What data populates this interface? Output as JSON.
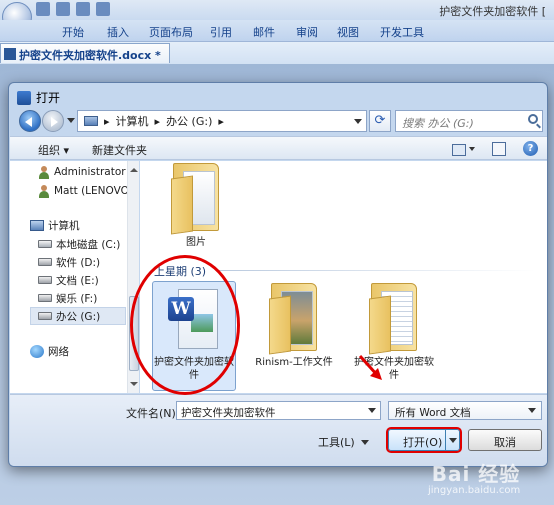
{
  "word": {
    "doc_title": "护密文件夹加密软件 [",
    "tabs": [
      "开始",
      "插入",
      "页面布局",
      "引用",
      "邮件",
      "审阅",
      "视图",
      "开发工具"
    ],
    "doc_tab": "护密文件夹加密软件.docx *"
  },
  "dialog": {
    "title": "打开",
    "breadcrumb": [
      "计算机",
      "办公 (G:)"
    ],
    "search_placeholder": "搜索 办公 (G:)",
    "toolbar": {
      "organize": "组织 ▾",
      "new_folder": "新建文件夹"
    },
    "nav": [
      {
        "label": "Administrator (",
        "icon": "user-icon"
      },
      {
        "label": "Matt (LENOVO-",
        "icon": "user-icon"
      },
      {
        "label": "计算机",
        "icon": "computer-icon"
      },
      {
        "label": "本地磁盘 (C:)",
        "icon": "drive-icon"
      },
      {
        "label": "软件 (D:)",
        "icon": "drive-icon"
      },
      {
        "label": "文档 (E:)",
        "icon": "drive-icon"
      },
      {
        "label": "娱乐 (F:)",
        "icon": "drive-icon"
      },
      {
        "label": "办公 (G:)",
        "icon": "drive-icon",
        "selected": true
      },
      {
        "label": "网络",
        "icon": "network-icon"
      }
    ],
    "files": {
      "top": {
        "label": "图片"
      },
      "group_header": "上星期 (3)",
      "items": [
        {
          "label": "护密文件夹加密软件",
          "type": "word-document"
        },
        {
          "label": "Rinism-工作文件",
          "type": "folder"
        },
        {
          "label": "护密文件夹加密软件",
          "type": "folder"
        }
      ]
    },
    "bottom": {
      "filename_label": "文件名(N):",
      "filename_value": "护密文件夹加密软件",
      "filetype_value": "所有 Word 文档",
      "tools_label": "工具(L)",
      "open_label": "打开(O)",
      "cancel_label": "取消"
    }
  },
  "watermark": {
    "line1": "Bai 经验",
    "line2": "jingyan.baidu.com"
  },
  "colors": {
    "annotation_red": "#e00000",
    "dialog_bg": "#c4d7ee",
    "selection": "#d9e8fb"
  }
}
